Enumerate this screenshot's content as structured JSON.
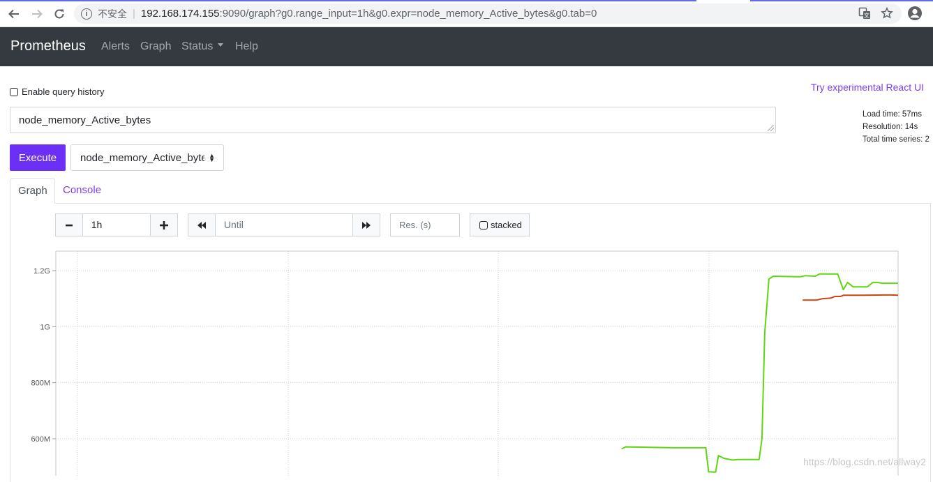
{
  "browser": {
    "security_label": "不安全",
    "url_host": "192.168.174.155",
    "url_rest": ":9090/graph?g0.range_input=1h&g0.expr=node_memory_Active_bytes&g0.tab=0"
  },
  "navbar": {
    "brand": "Prometheus",
    "links": [
      "Alerts",
      "Graph",
      "Status",
      "Help"
    ]
  },
  "query": {
    "history_label": "Enable query history",
    "react_link": "Try experimental React UI",
    "expression": "node_memory_Active_bytes",
    "execute_label": "Execute",
    "metric_selected": "node_memory_Active_bytes",
    "stats": {
      "load_time": "Load time: 57ms",
      "resolution": "Resolution: 14s",
      "total_series": "Total time series: 2"
    }
  },
  "tabs": [
    "Graph",
    "Console"
  ],
  "controls": {
    "range_value": "1h",
    "until_placeholder": "Until",
    "res_placeholder": "Res. (s)",
    "stacked_label": "stacked"
  },
  "colors": {
    "series_green": "#5fd60f",
    "series_red": "#cc4410",
    "accent": "#6b2ff5"
  },
  "chart_data": {
    "type": "line",
    "y_tick_labels": [
      "1.2G",
      "1G",
      "800M",
      "600M"
    ],
    "y_tick_values": [
      1200000000,
      1000000000,
      800000000,
      600000000
    ],
    "ylim": [
      530000000,
      1270000000
    ],
    "x_range": [
      0,
      60
    ],
    "grid": true,
    "series": [
      {
        "color": "#5fd60f",
        "points": [
          [
            40.3,
            564000000
          ],
          [
            40.6,
            571000000
          ],
          [
            41.5,
            570000000
          ],
          [
            44,
            568000000
          ],
          [
            46.3,
            568000000
          ],
          [
            46.5,
            482000000
          ],
          [
            47,
            481000000
          ],
          [
            47.2,
            540000000
          ],
          [
            47.6,
            530000000
          ],
          [
            48.2,
            524000000
          ],
          [
            48.6,
            526000000
          ],
          [
            50.1,
            526000000
          ],
          [
            50.3,
            600000000
          ],
          [
            50.5,
            980000000
          ],
          [
            50.8,
            1170000000
          ],
          [
            51.1,
            1180000000
          ],
          [
            53.0,
            1178000000
          ],
          [
            53.4,
            1182000000
          ],
          [
            54.1,
            1180000000
          ],
          [
            54.4,
            1188000000
          ],
          [
            55.7,
            1188000000
          ],
          [
            56.1,
            1132000000
          ],
          [
            56.4,
            1158000000
          ],
          [
            56.8,
            1142000000
          ],
          [
            57.8,
            1142000000
          ],
          [
            58.2,
            1158000000
          ],
          [
            58.5,
            1158000000
          ],
          [
            58.9,
            1155000000
          ],
          [
            60.0,
            1155000000
          ]
        ]
      },
      {
        "color": "#cc4410",
        "points": [
          [
            53.2,
            1095000000
          ],
          [
            54.2,
            1095000000
          ],
          [
            54.6,
            1100000000
          ],
          [
            55.2,
            1102000000
          ],
          [
            55.5,
            1108000000
          ],
          [
            55.9,
            1108000000
          ],
          [
            56.1,
            1112000000
          ],
          [
            57.5,
            1112000000
          ],
          [
            59.0,
            1113000000
          ],
          [
            59.5,
            1113000000
          ],
          [
            60.0,
            1112000000
          ]
        ]
      }
    ]
  },
  "watermark": "https://blog.csdn.net/allway2"
}
